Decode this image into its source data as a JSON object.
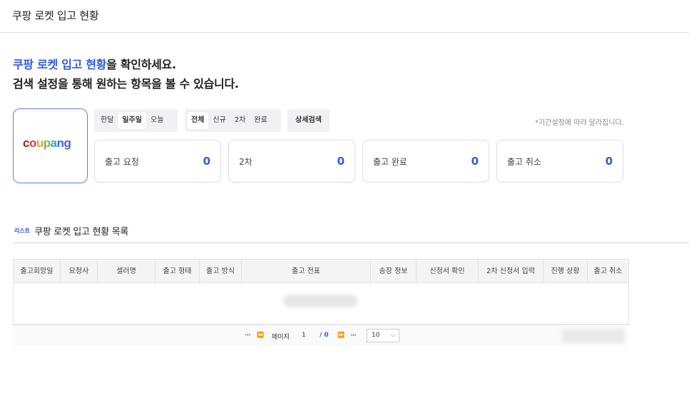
{
  "header": {
    "title": "쿠팡 로켓 입고 현황"
  },
  "headline": {
    "accent": "쿠팡 로켓 입고 현황",
    "line1_rest": "을 확인하세요.",
    "line2": "검색 설정을 통해 원하는 항목을 볼 수 있습니다."
  },
  "logo": {
    "parts": [
      "c",
      "o",
      "u",
      "p",
      "a",
      "ng"
    ]
  },
  "period_filter": {
    "options": [
      "한달",
      "일주일",
      "오늘"
    ],
    "selected": "일주일"
  },
  "type_filter": {
    "options": [
      "전체",
      "신규",
      "2차",
      "완료"
    ],
    "selected": "전체"
  },
  "detail_search": {
    "label": "상세검색"
  },
  "period_note": "*기간설정에 따라 달라집니다.",
  "stats": [
    {
      "label": "출고 요청",
      "value": "0"
    },
    {
      "label": "2차",
      "value": "0"
    },
    {
      "label": "출고 완료",
      "value": "0"
    },
    {
      "label": "출고 취소",
      "value": "0"
    }
  ],
  "list_section": {
    "tag": "리스트",
    "title": "쿠팡 로켓 입고 현황 목록"
  },
  "table": {
    "columns": [
      "출고희망일",
      "요청사",
      "셀러명",
      "출고 형태",
      "출고 방식",
      "출고 전표",
      "송장 정보",
      "신청서 확인",
      "2차 신청서 입력",
      "진행 상황",
      "출고 취소"
    ]
  },
  "pager": {
    "first": "⏮",
    "prev": "⏪",
    "next": "⏩",
    "last": "⏭",
    "page_label": "페이지",
    "page": "1",
    "total": "/ 0",
    "page_size": "10"
  },
  "colors": {
    "accent": "#2f5bdc",
    "border": "#d9d9d9",
    "note": "#888888"
  }
}
